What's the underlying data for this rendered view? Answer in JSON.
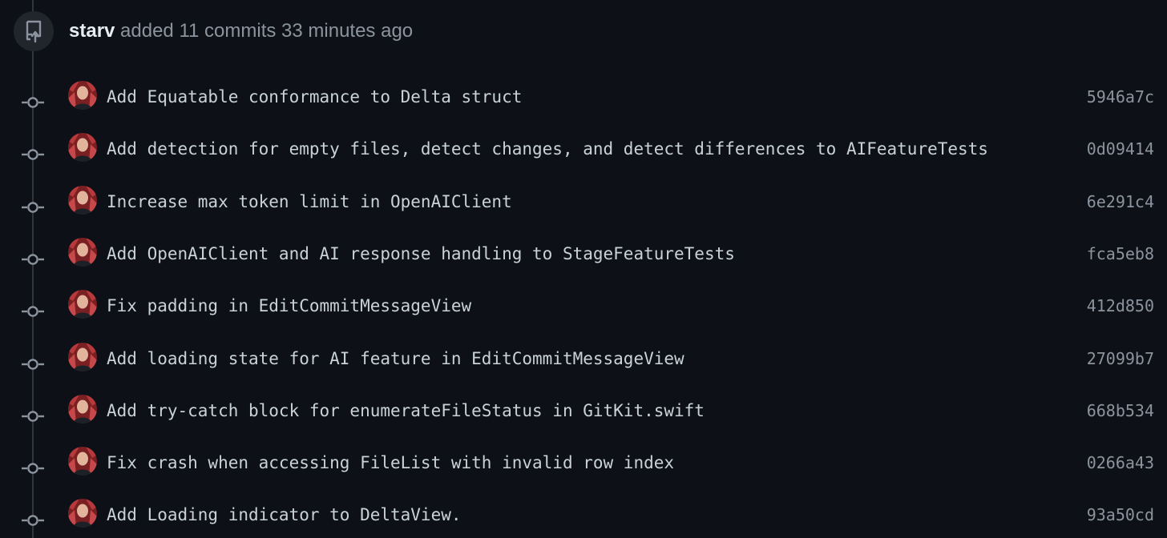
{
  "header": {
    "icon": "repo-push-icon",
    "author": "starv",
    "action": " added 11 commits 33 minutes ago"
  },
  "commits": [
    {
      "message": "Add Equatable conformance to Delta struct",
      "sha": "5946a7c"
    },
    {
      "message": "Add detection for empty files, detect changes, and detect differences to AIFeatureTests",
      "sha": "0d09414"
    },
    {
      "message": "Increase max token limit in OpenAIClient",
      "sha": "6e291c4"
    },
    {
      "message": "Add OpenAIClient and AI response handling to StageFeatureTests",
      "sha": "fca5eb8"
    },
    {
      "message": "Fix padding in EditCommitMessageView",
      "sha": "412d850"
    },
    {
      "message": "Add loading state for AI feature in EditCommitMessageView",
      "sha": "27099b7"
    },
    {
      "message": "Add try-catch block for enumerateFileStatus in GitKit.swift",
      "sha": "668b534"
    },
    {
      "message": "Fix crash when accessing FileList with invalid row index",
      "sha": "0266a43"
    },
    {
      "message": "Add Loading indicator to DeltaView.",
      "sha": "93a50cd"
    }
  ],
  "colors": {
    "background": "#0d1117",
    "timeline": "#30363d",
    "text": "#c9d1d9",
    "muted": "#8b949e"
  }
}
